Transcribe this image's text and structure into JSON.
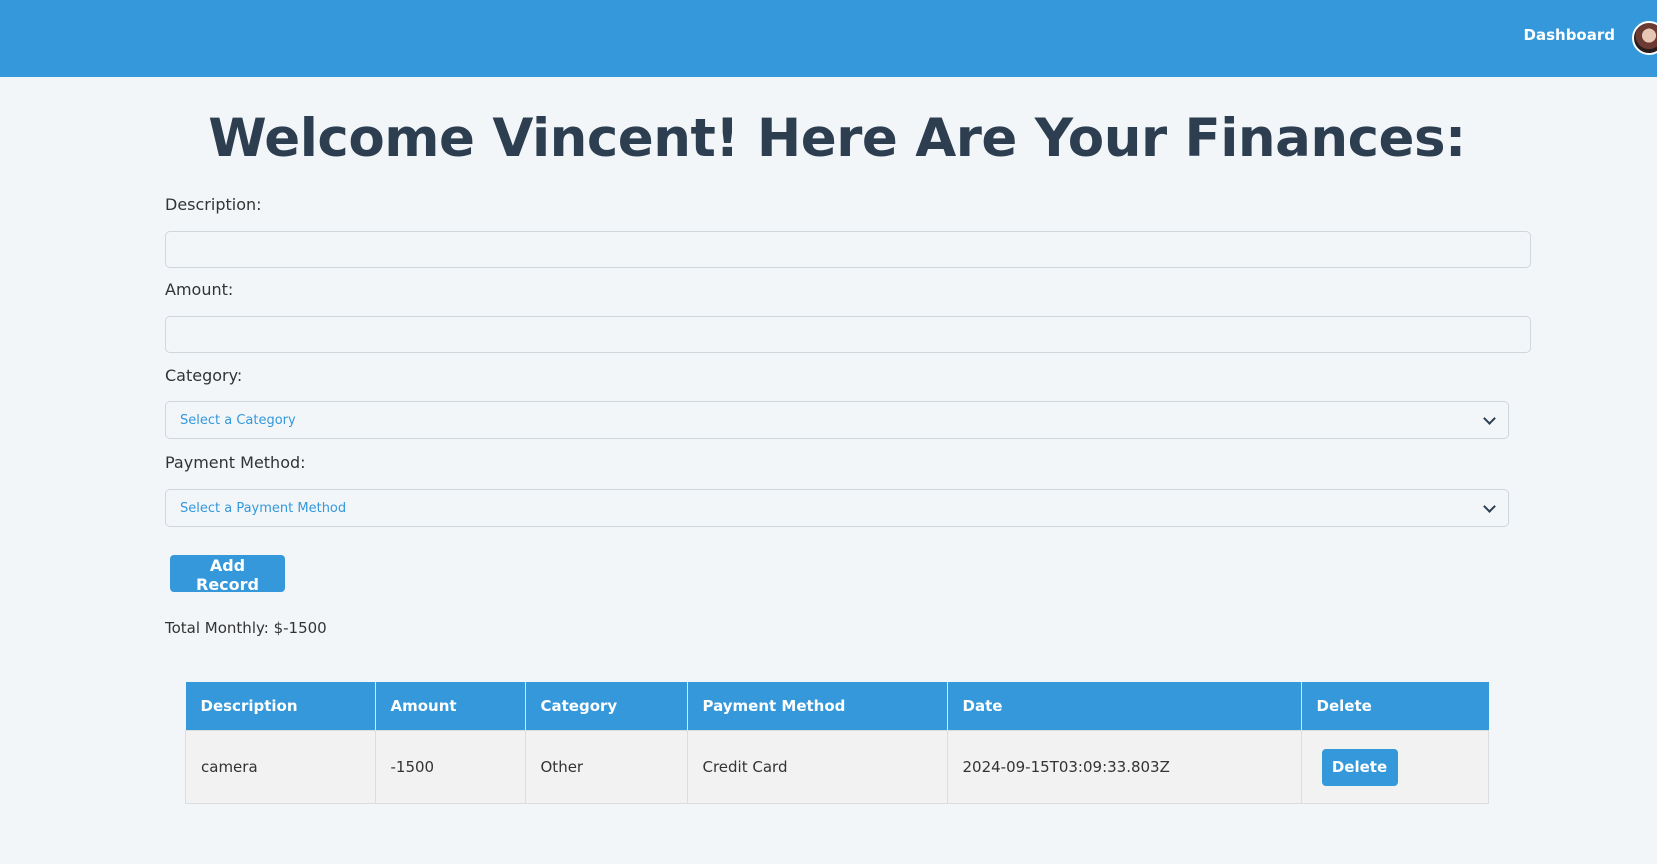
{
  "nav": {
    "dashboard_label": "Dashboard"
  },
  "page": {
    "title": "Welcome Vincent! Here Are Your Finances:"
  },
  "form": {
    "description_label": "Description:",
    "description_value": "",
    "amount_label": "Amount:",
    "amount_value": "",
    "category_label": "Category:",
    "category_selected": "Select a Category",
    "payment_label": "Payment Method:",
    "payment_selected": "Select a Payment Method",
    "add_button_label": "Add Record"
  },
  "summary": {
    "total_monthly": "Total Monthly: $-1500"
  },
  "table": {
    "headers": [
      "Description",
      "Amount",
      "Category",
      "Payment Method",
      "Date",
      "Delete"
    ],
    "rows": [
      {
        "description": "camera",
        "amount": "-1500",
        "category": "Other",
        "payment_method": "Credit Card",
        "date": "2024-09-15T03:09:33.803Z",
        "delete_label": "Delete"
      }
    ]
  },
  "colors": {
    "brand": "#3498db",
    "heading": "#2c3e50",
    "background": "#f3f6f9"
  }
}
